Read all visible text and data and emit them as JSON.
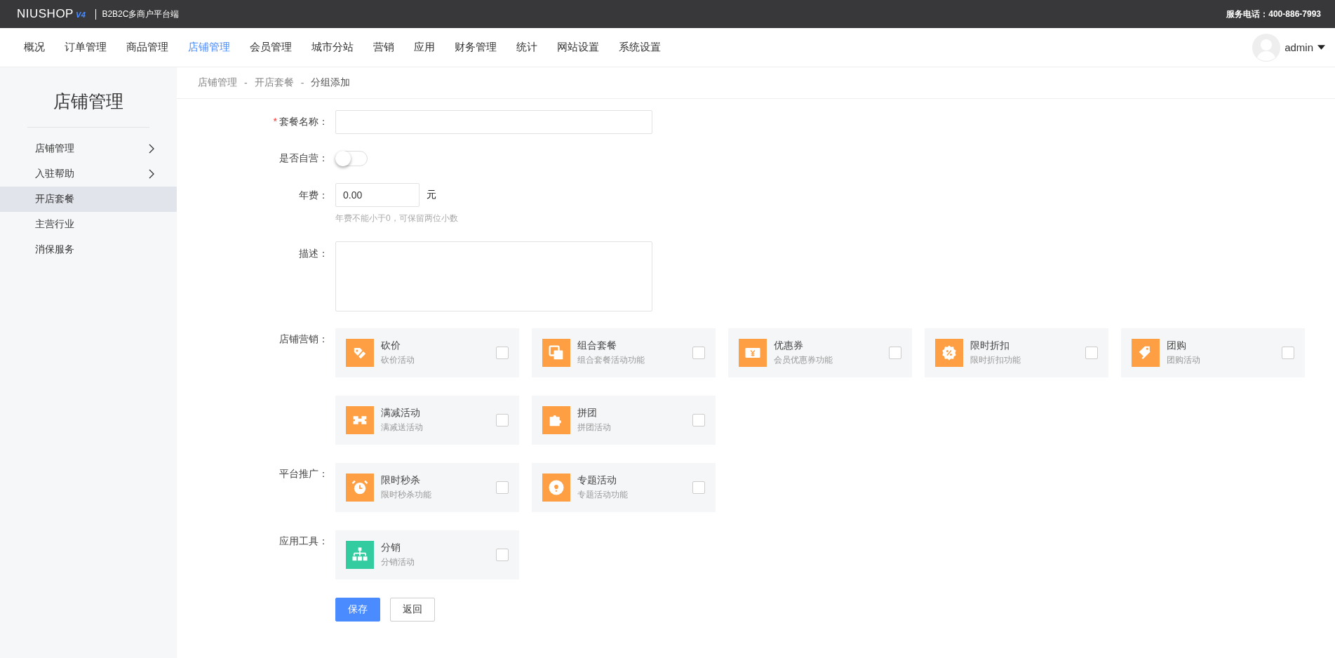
{
  "header": {
    "logo": "NIUSHOP",
    "logo_version": "V4",
    "subtitle": "B2B2C多商户平台端",
    "hotline": "服务电话：400-886-7993"
  },
  "nav": [
    {
      "label": "概况",
      "selected": false
    },
    {
      "label": "订单管理",
      "selected": false
    },
    {
      "label": "商品管理",
      "selected": false
    },
    {
      "label": "店铺管理",
      "selected": true
    },
    {
      "label": "会员管理",
      "selected": false
    },
    {
      "label": "城市分站",
      "selected": false
    },
    {
      "label": "营销",
      "selected": false
    },
    {
      "label": "应用",
      "selected": false
    },
    {
      "label": "财务管理",
      "selected": false
    },
    {
      "label": "统计",
      "selected": false
    },
    {
      "label": "网站设置",
      "selected": false
    },
    {
      "label": "系统设置",
      "selected": false
    }
  ],
  "user": {
    "name": "admin"
  },
  "sidebar": {
    "title": "店铺管理",
    "items": [
      {
        "label": "店铺管理",
        "kind": "group",
        "selected": false
      },
      {
        "label": "入驻帮助",
        "kind": "group",
        "selected": false
      },
      {
        "label": "开店套餐",
        "kind": "link",
        "selected": true
      },
      {
        "label": "主营行业",
        "kind": "link",
        "selected": false
      },
      {
        "label": "消保服务",
        "kind": "link",
        "selected": false
      }
    ]
  },
  "breadcrumb": [
    "店铺管理",
    "开店套餐",
    "分组添加"
  ],
  "breadcrumb_separator": "-",
  "form": {
    "name": {
      "label": "套餐名称：",
      "required": true,
      "required_mark": "*"
    },
    "self_run": {
      "label": "是否自营：",
      "on": false
    },
    "fee": {
      "label": "年费：",
      "value": "0.00",
      "unit": "元",
      "hint": "年费不能小于0，可保留两位小数"
    },
    "description": {
      "label": "描述："
    },
    "groups": [
      {
        "label": "店铺营销：",
        "plugins": [
          {
            "title": "砍价",
            "desc": "砍价活动",
            "color": "#ff9f43",
            "checked": false
          },
          {
            "title": "组合套餐",
            "desc": "组合套餐活动功能",
            "color": "#ff9f43",
            "checked": false
          },
          {
            "title": "优惠券",
            "desc": "会员优惠券功能",
            "color": "#ff9f43",
            "checked": false
          },
          {
            "title": "限时折扣",
            "desc": "限时折扣功能",
            "color": "#ff9f43",
            "checked": false
          },
          {
            "title": "团购",
            "desc": "团购活动",
            "color": "#ff9f43",
            "checked": false
          },
          {
            "title": "满减活动",
            "desc": "满减送活动",
            "color": "#ff9f43",
            "checked": false
          },
          {
            "title": "拼团",
            "desc": "拼团活动",
            "color": "#ff9f43",
            "checked": false
          }
        ]
      },
      {
        "label": "平台推广：",
        "plugins": [
          {
            "title": "限时秒杀",
            "desc": "限时秒杀功能",
            "color": "#ff9f43",
            "checked": false
          },
          {
            "title": "专题活动",
            "desc": "专题活动功能",
            "color": "#ff9f43",
            "checked": false
          }
        ]
      },
      {
        "label": "应用工具：",
        "plugins": [
          {
            "title": "分销",
            "desc": "分销活动",
            "color": "#33cca0",
            "checked": false
          }
        ]
      }
    ],
    "buttons": {
      "save": "保存",
      "back": "返回"
    }
  }
}
